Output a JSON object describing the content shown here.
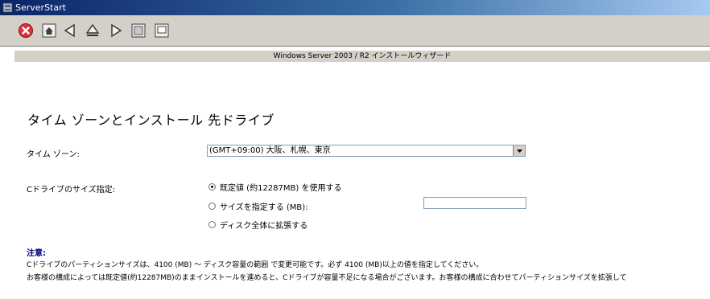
{
  "window": {
    "title": "ServerStart"
  },
  "toolbar": {
    "buttons": [
      {
        "name": "exit-button",
        "icon": "close-circle-icon"
      },
      {
        "name": "home-button",
        "icon": "home-icon"
      },
      {
        "name": "back-button",
        "icon": "triangle-left-icon"
      },
      {
        "name": "top-button",
        "icon": "eject-icon"
      },
      {
        "name": "next-button",
        "icon": "triangle-right-icon"
      },
      {
        "name": "window-button",
        "icon": "window-icon"
      },
      {
        "name": "help-button",
        "icon": "document-icon"
      }
    ]
  },
  "wizard": {
    "band_title": "Windows Server 2003 / R2 インストールウィザード",
    "heading": "タイム ゾーンとインストール 先ドライブ"
  },
  "timezone": {
    "label": "タイム ゾーン:",
    "selected": "(GMT+09:00) 大阪、札幌、東京"
  },
  "drive": {
    "label": "Cドライブのサイズ指定:",
    "options": [
      {
        "label": "既定値 (約12287MB) を使用する",
        "checked": true
      },
      {
        "label": "サイズを指定する (MB):",
        "checked": false
      },
      {
        "label": "ディスク全体に拡張する",
        "checked": false
      }
    ],
    "size_value": ""
  },
  "note": {
    "title": "注意:",
    "line1": "Cドライブのパーティションサイズは、4100 (MB) ～ ディスク容量の範囲 で変更可能です。必ず 4100 (MB)以上の値を指定してください。",
    "line2": "お客様の構成によっては既定値(約12287MB)のままインストールを進めると、Cドライブが容量不足になる場合がございます。お客様の構成に合わせてパーティションサイズを拡張して"
  },
  "colors": {
    "titlebar_start": "#0a246a",
    "toolbar_bg": "#d4d0c8",
    "note_title": "#00007f"
  }
}
